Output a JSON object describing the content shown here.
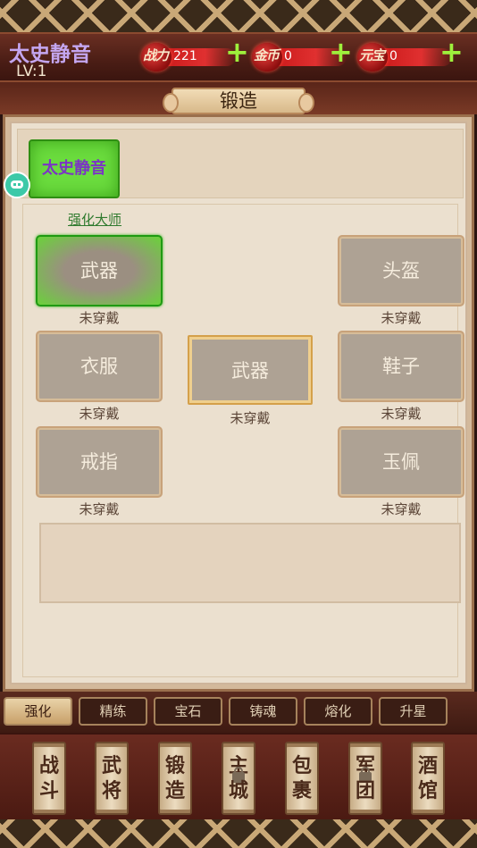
{
  "header": {
    "player_name": "太史静音",
    "level": "LV:1",
    "stats": [
      {
        "label": "战力",
        "value": "221"
      },
      {
        "label": "金币",
        "value": "0"
      },
      {
        "label": "元宝",
        "value": "0"
      }
    ],
    "plus_symbol": "+"
  },
  "panel_title": "锻造",
  "character": {
    "name": "太史静音"
  },
  "master_link": "强化大师",
  "slots": {
    "weapon": {
      "label": "武器",
      "status": "未穿戴"
    },
    "helmet": {
      "label": "头盔",
      "status": "未穿戴"
    },
    "clothes": {
      "label": "衣服",
      "status": "未穿戴"
    },
    "center": {
      "label": "武器",
      "status": "未穿戴"
    },
    "shoes": {
      "label": "鞋子",
      "status": "未穿戴"
    },
    "ring": {
      "label": "戒指",
      "status": "未穿戴"
    },
    "jade": {
      "label": "玉佩",
      "status": "未穿戴"
    }
  },
  "tabs": [
    {
      "label": "强化",
      "active": true
    },
    {
      "label": "精练",
      "locked": true
    },
    {
      "label": "宝石",
      "locked": true
    },
    {
      "label": "铸魂",
      "locked": true
    },
    {
      "label": "熔化",
      "locked": true
    },
    {
      "label": "升星",
      "locked": true
    }
  ],
  "nav": [
    {
      "top": "战",
      "bottom": "斗"
    },
    {
      "top": "武",
      "bottom": "将"
    },
    {
      "top": "锻",
      "bottom": "造"
    },
    {
      "top": "主",
      "bottom": "城",
      "locked": true
    },
    {
      "top": "包",
      "bottom": "裹"
    },
    {
      "top": "军",
      "bottom": "团",
      "locked": true
    },
    {
      "top": "酒",
      "bottom": "馆"
    }
  ],
  "colors": {
    "accent_green": "#6bdc3e",
    "name_purple": "#c4a6f0",
    "stat_red": "#c81818"
  }
}
